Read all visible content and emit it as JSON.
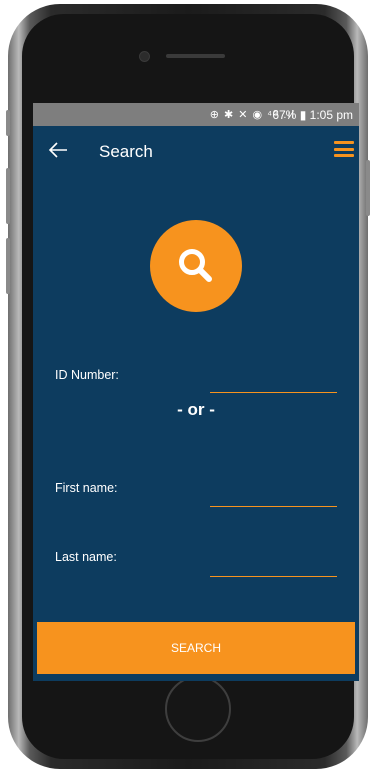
{
  "statusbar": {
    "icons": "⊕ ✱ ✕ ◉ ⁴ᴳ .ıl",
    "battery": "67%",
    "time": "1:05 pm"
  },
  "appbar": {
    "back_icon": "arrow-left-icon",
    "title": "Search",
    "menu_icon": "hamburger-menu-icon"
  },
  "hero": {
    "icon": "search-icon"
  },
  "form": {
    "id_label": "ID Number:",
    "id_value": "",
    "or_text": "- or -",
    "first_label": "First name:",
    "first_value": "",
    "last_label": "Last name:",
    "last_value": ""
  },
  "actions": {
    "search_label": "SEARCH"
  },
  "colors": {
    "background": "#0d3c5f",
    "accent": "#f7931e",
    "statusbar": "#7e7e7e"
  }
}
